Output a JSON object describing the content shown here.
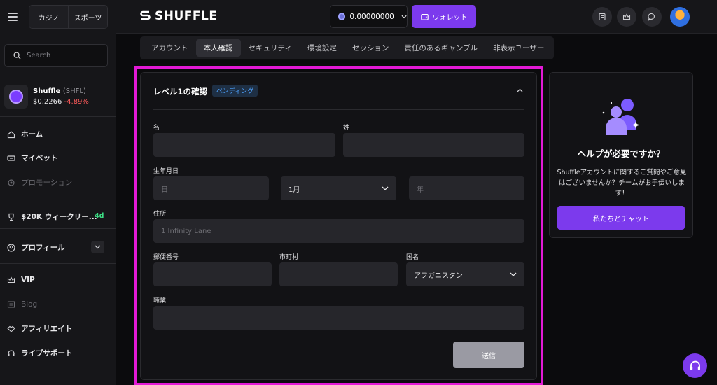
{
  "sidebar": {
    "segments": [
      "カジノ",
      "スポーツ"
    ],
    "search_placeholder": "Search",
    "token": {
      "name": "Shuffle",
      "symbol": "(SHFL)",
      "price": "$0.2266",
      "change": "-4.89%"
    },
    "nav": {
      "home": "ホーム",
      "mybets": "マイベット",
      "promotions": "プロモーション",
      "weekly": "$20K ウィークリー...",
      "weekly_badge": "4d",
      "profile": "プロフィール",
      "vip": "VIP",
      "blog": "Blog",
      "affiliate": "アフィリエイト",
      "support": "ライブサポート"
    }
  },
  "header": {
    "logo_text": "SHUFFLE",
    "balance": "0.00000000",
    "wallet_label": "ウォレット"
  },
  "tabs": [
    "アカウント",
    "本人確認",
    "セキュリティ",
    "環境設定",
    "セッション",
    "責任のあるギャンブル",
    "非表示ユーザー"
  ],
  "active_tab": "本人確認",
  "form": {
    "title": "レベル1の確認",
    "status": "ペンディング",
    "first_name_label": "名",
    "last_name_label": "姓",
    "dob_label": "生年月日",
    "day_placeholder": "日",
    "month_value": "1月",
    "year_placeholder": "年",
    "address_label": "住所",
    "address_placeholder": "1 Infinity Lane",
    "postal_label": "郵便番号",
    "city_label": "市町村",
    "country_label": "国名",
    "country_value": "アフガニスタン",
    "occupation_label": "職業",
    "submit_label": "送信"
  },
  "help": {
    "title": "ヘルプが必要ですか？",
    "body": "Shuffleアカウントに関するご質問やご意見はございませんか？チームがお手伝いします！",
    "button": "私たちとチャット"
  },
  "colors": {
    "accent": "#7c3aed",
    "highlight": "#e31ad6",
    "pending": "#4fa3ff",
    "negative": "#ff5a5a",
    "badge": "#3ddc84"
  }
}
